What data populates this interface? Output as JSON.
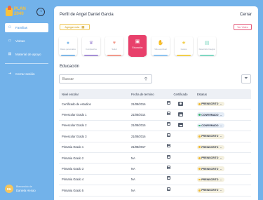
{
  "app": {
    "logo_text": "PLAN 2040",
    "logo_line1": "PLAN",
    "logo_line2": "2040"
  },
  "sidebar": {
    "items": [
      {
        "label": "Familias",
        "icon": "people-icon",
        "active": true
      },
      {
        "label": "Visitas",
        "icon": "folder-icon",
        "active": false
      },
      {
        "label": "Material de apoyo",
        "icon": "book-icon",
        "active": false
      }
    ],
    "logout_label": "Cerrar sesión",
    "user": {
      "initials": "DH",
      "caption": "Bienvenido de",
      "name": "Daniela Henao"
    }
  },
  "header": {
    "title": "Perfil de Angel Daniel Garcia",
    "close_label": "Cerrar"
  },
  "buttons": {
    "agregar": "Agregar nota",
    "ver_video": "Ver Video"
  },
  "categories": [
    {
      "label": "Datos personales",
      "color": "#7fb8e8",
      "glyph": "●",
      "active": false
    },
    {
      "label": "Cumpleaños",
      "color": "#a58fd6",
      "glyph": "♛",
      "active": false
    },
    {
      "label": "Salud",
      "color": "#f29a8c",
      "glyph": "♥",
      "active": false
    },
    {
      "label": "Educación",
      "color": "#e8406b",
      "glyph": "▣",
      "active": true
    },
    {
      "label": "Vida espiritual",
      "color": "#8ec3f0",
      "glyph": "✋",
      "active": false
    },
    {
      "label": "Gustos",
      "color": "#f2cf4c",
      "glyph": "★",
      "active": false
    },
    {
      "label": "Desarrollo Integral",
      "color": "#7fd8c2",
      "glyph": "▤",
      "active": false
    }
  ],
  "section": {
    "title": "Educación"
  },
  "search": {
    "placeholder": "Buscar"
  },
  "table": {
    "headers": [
      "Nivel escolar",
      "Fecha de termino",
      "Certificado",
      "Estatus"
    ],
    "rows": [
      {
        "nivel": "Certificado de estudios",
        "fecha": "21/08/2016",
        "cert": "image",
        "status": "PREINSCRITO"
      },
      {
        "nivel": "Preescolar Grado 1",
        "fecha": "21/08/2014",
        "cert": "photo",
        "status": "CONFIRMADO"
      },
      {
        "nivel": "Preescolar Grado 2",
        "fecha": "21/08/2015",
        "cert": "photo",
        "status": "CONFIRMADO"
      },
      {
        "nivel": "Preescolar Grado 3",
        "fecha": "21/08/2016",
        "cert": "",
        "status": "PREINSCRITO"
      },
      {
        "nivel": "Primaria Grado 1",
        "fecha": "21/08/2017",
        "cert": "",
        "status": "PREINSCRITO"
      },
      {
        "nivel": "Primaria Grado 2",
        "fecha": "NA",
        "cert": "",
        "status": "PREINSCRITO"
      },
      {
        "nivel": "Primaria Grado 3",
        "fecha": "NA",
        "cert": "",
        "status": "PREINSCRITO"
      },
      {
        "nivel": "Primaria Grado 4",
        "fecha": "NA",
        "cert": "",
        "status": "PREINSCRITO"
      },
      {
        "nivel": "Primaria Grado 5",
        "fecha": "NA",
        "cert": "",
        "status": "PREINSCRITO"
      }
    ]
  },
  "colors": {
    "sidebar_bg": "#72b2ea",
    "accent_pink": "#e8406b",
    "accent_yellow": "#f0c75a",
    "confirmed_dot": "#37b36a",
    "preinscrito_dot": "#f0b72d"
  }
}
